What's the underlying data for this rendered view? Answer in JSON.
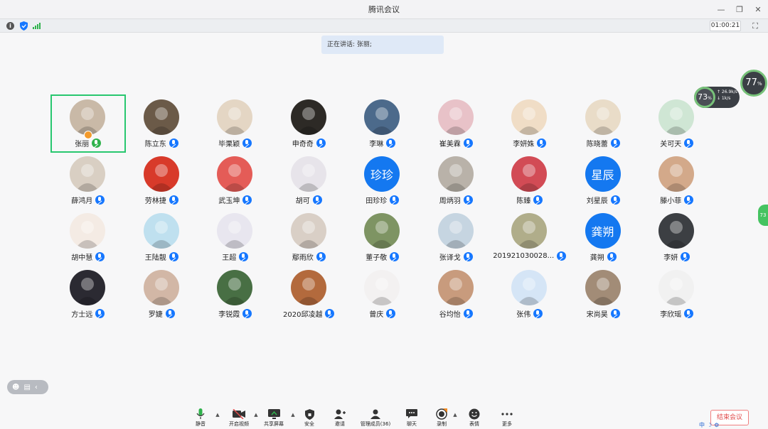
{
  "window": {
    "title": "腾讯会议",
    "minimize": "—",
    "restore": "❐",
    "close": "✕"
  },
  "infobar": {
    "timer": "01:00:21",
    "info_glyph": "i",
    "fullscreen_glyph": "⛶"
  },
  "speaking": "正在讲话: 张丽;",
  "participants": [
    {
      "name": "张丽",
      "mic": "green",
      "host": true,
      "bg": "#c9b9a7"
    },
    {
      "name": "陈立东",
      "bg": "#6b5a48"
    },
    {
      "name": "毕栗颖",
      "bg": "#e4d6c4"
    },
    {
      "name": "申奇奇",
      "bg": "#2d2a26"
    },
    {
      "name": "李琳",
      "bg": "#4c6a8b"
    },
    {
      "name": "崔美霖",
      "bg": "#e8c2c8"
    },
    {
      "name": "李妍姝",
      "bg": "#f0ddc6"
    },
    {
      "name": "陈晓蕾",
      "bg": "#e9dcc8"
    },
    {
      "name": "关可天",
      "bg": "#cfe6d4"
    },
    {
      "name": "薛鸿月",
      "bg": "#d9cfc3"
    },
    {
      "name": "劳林捷",
      "bg": "#d83a2a"
    },
    {
      "name": "武玉坤",
      "bg": "#e45c57"
    },
    {
      "name": "胡可",
      "bg": "#e7e4ea"
    },
    {
      "name": "田珍珍",
      "text": "珍珍"
    },
    {
      "name": "周炳羽",
      "bg": "#b9b2a9"
    },
    {
      "name": "陈臻",
      "bg": "#d24b55"
    },
    {
      "name": "刘星辰",
      "text": "星辰"
    },
    {
      "name": "滕小菲",
      "bg": "#d3a98a"
    },
    {
      "name": "胡中慧",
      "bg": "#f4ebe4"
    },
    {
      "name": "王陆靓",
      "bg": "#bfe0ef"
    },
    {
      "name": "王超",
      "bg": "#e8e6ef"
    },
    {
      "name": "鄢雨欣",
      "bg": "#d9cfc6"
    },
    {
      "name": "董子敬",
      "bg": "#7e9463"
    },
    {
      "name": "张译戈",
      "bg": "#c6d5e1"
    },
    {
      "name": "201921030028...",
      "bg": "#b0ad8a"
    },
    {
      "name": "龚朔",
      "text": "龚朔"
    },
    {
      "name": "李妍",
      "bg": "#3c3f43"
    },
    {
      "name": "方士远",
      "bg": "#2b2a32"
    },
    {
      "name": "罗婕",
      "bg": "#d2b7a6"
    },
    {
      "name": "李锐霞",
      "bg": "#486f44"
    },
    {
      "name": "2020邱凌越",
      "bg": "#b36a3d"
    },
    {
      "name": "曾庆",
      "bg": "#f3f1f1"
    },
    {
      "name": "谷均怡",
      "bg": "#c89b7d"
    },
    {
      "name": "张伟",
      "bg": "#d5e5f6"
    },
    {
      "name": "宋尚昊",
      "bg": "#a28c77"
    },
    {
      "name": "李欣瑶",
      "bg": "#f1f1f1"
    }
  ],
  "perf": {
    "cpu": "73",
    "cpu_unit": "%",
    "net": "77",
    "net_unit": "%",
    "stat1": "↑ 26.9k/s",
    "stat2": "↓ 1k/s",
    "side_tab": "73"
  },
  "float_left": {
    "a": "☻",
    "b": "▤",
    "c": "‹"
  },
  "toolbar": {
    "mute": "静音",
    "video": "开启视频",
    "share": "共享屏幕",
    "security": "安全",
    "invite": "邀请",
    "members": "管理成员(36)",
    "chat": "聊天",
    "record": "录制",
    "reaction": "表情",
    "more": "更多"
  },
  "end_meeting": "结束会议",
  "tray": {
    "a": "中",
    "b": "☽",
    "c": "⚙"
  },
  "colors": {
    "accent": "#1677ff",
    "active": "#28c76f",
    "end": "#e04a4a"
  }
}
